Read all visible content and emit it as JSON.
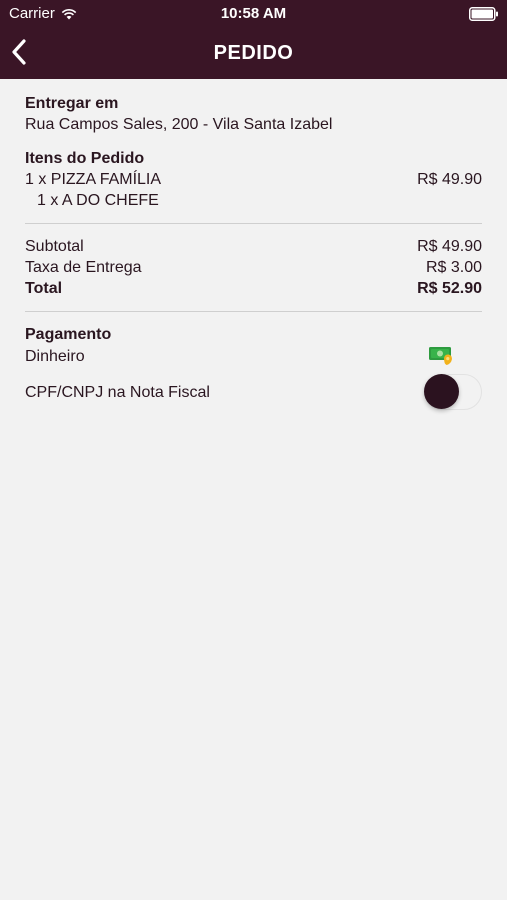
{
  "status_bar": {
    "carrier": "Carrier",
    "time": "10:58 AM"
  },
  "nav": {
    "title": "PEDIDO",
    "back_icon": "chevron-left-icon"
  },
  "delivery": {
    "title": "Entregar em",
    "address": "Rua Campos Sales, 200 - Vila Santa Izabel"
  },
  "items": {
    "title": "Itens do Pedido",
    "list": [
      {
        "name": "1 x PIZZA FAMÍLIA",
        "price": "R$ 49.90",
        "sub": "1 x A DO CHEFE"
      }
    ]
  },
  "summary": {
    "subtotal_label": "Subtotal",
    "subtotal_value": "R$ 49.90",
    "fee_label": "Taxa de Entrega",
    "fee_value": "R$ 3.00",
    "total_label": "Total",
    "total_value": "R$ 52.90"
  },
  "payment": {
    "title": "Pagamento",
    "method": "Dinheiro",
    "method_icon": "cash-icon",
    "cpf_label": "CPF/CNPJ na Nota Fiscal",
    "cpf_enabled": false
  },
  "colors": {
    "brand": "#3a1526",
    "background": "#f2f2f2",
    "text": "#2a1620",
    "switch_knob": "#2b121f"
  }
}
